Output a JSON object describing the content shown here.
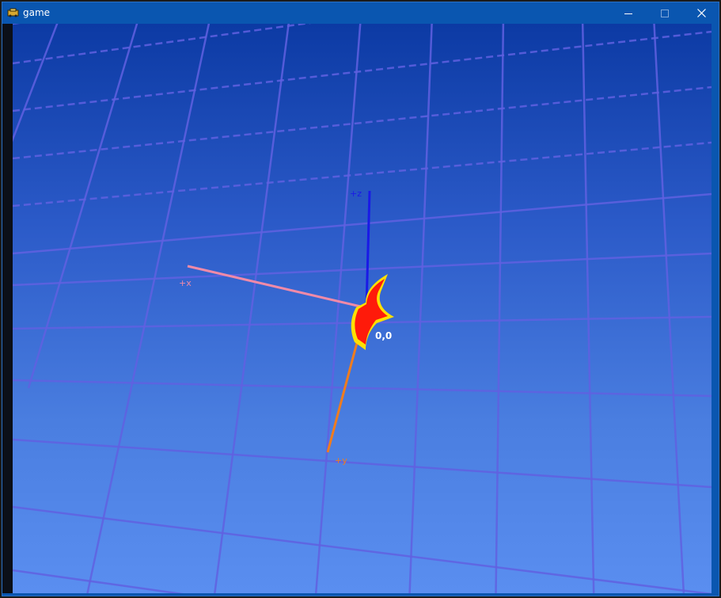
{
  "window": {
    "title": "game",
    "minimize_glyph": "minimize-icon",
    "maximize_glyph": "maximize-icon",
    "close_glyph": "close-icon"
  },
  "scene": {
    "origin_label": "0,0",
    "axes": {
      "x_label": "+x",
      "y_label": "+y",
      "z_label": "+z"
    },
    "colors": {
      "x_axis": "#f08aa8",
      "y_axis": "#f07c1e",
      "z_axis": "#1a1ae6",
      "grid": "#6060e0",
      "player_fill": "#ff1a0a",
      "player_edge": "#ffe000",
      "label_white": "#ffffff"
    },
    "player_sprite": "crescent-ship"
  }
}
